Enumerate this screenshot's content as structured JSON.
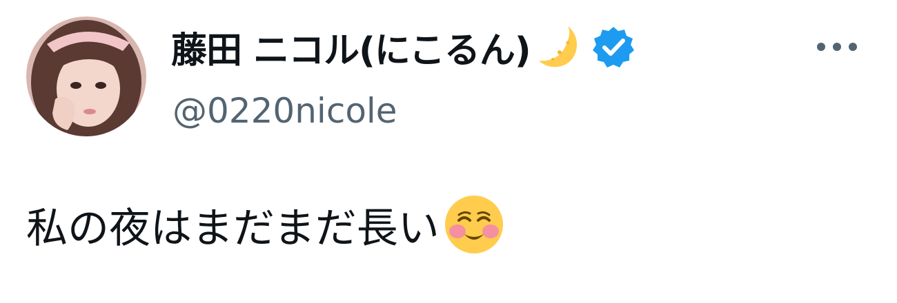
{
  "tweet": {
    "author": {
      "display_name": "藤田 ニコル(にこるん)",
      "handle": "@0220nicole",
      "name_emoji": "crescent-moon-icon",
      "verified": true,
      "verified_icon": "verified-badge-icon",
      "avatar_icon": "profile-avatar"
    },
    "more_icon": "more-horizontal-icon",
    "text": "私の夜はまだまだ長い",
    "text_emoji": "smiling-face-icon"
  },
  "colors": {
    "text_primary": "#0f1419",
    "text_secondary": "#536471",
    "verified_blue": "#1d9bf0",
    "background": "#ffffff"
  }
}
